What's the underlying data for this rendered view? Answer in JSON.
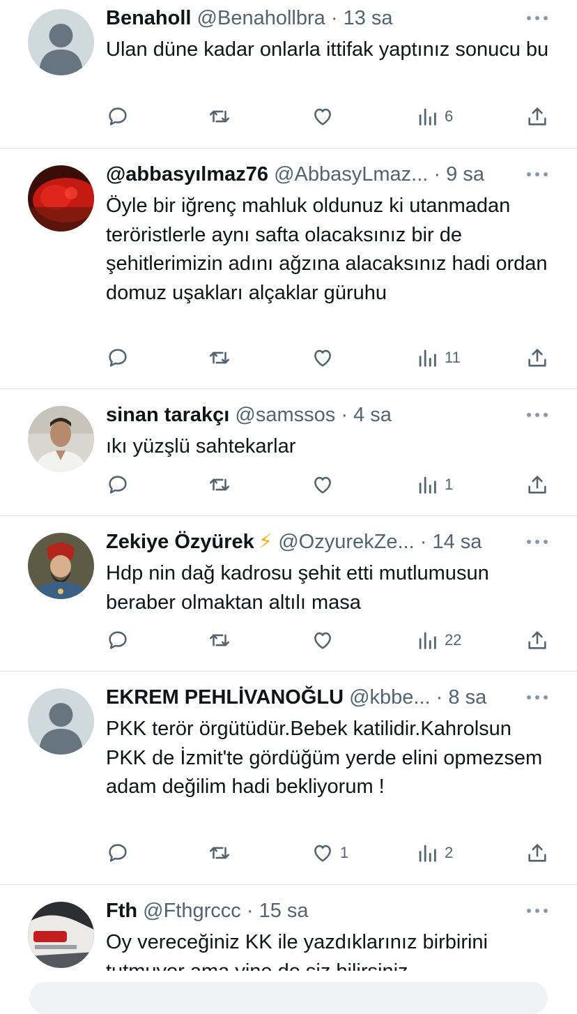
{
  "tweets": [
    {
      "name": "Benaholl",
      "handle": "@Benahollbra",
      "time": "13 sa",
      "text": "Ulan düne kadar onlarla ittifak yaptınız sonucu bu",
      "counts": {
        "reply": "",
        "retweet": "",
        "like": "",
        "views": "6"
      },
      "avatar": "default-avatar"
    },
    {
      "name": "@abbasyılmaz76",
      "handle": "@AbbasyLmaz...",
      "time": "9 sa",
      "text": "Öyle bir iğrenç mahluk oldunuz ki utanmadan  teröristlerle aynı safta olacaksınız bir de şehitlerimizin adını ağzına alacaksınız hadi ordan domuz uşakları alçaklar güruhu",
      "counts": {
        "reply": "",
        "retweet": "",
        "like": "",
        "views": "11"
      },
      "avatar": "red-flag-photo"
    },
    {
      "name": "sinan tarakçı",
      "handle": "@samssos",
      "time": "4 sa",
      "text": "ıkı yüzşlü sahtekarlar",
      "counts": {
        "reply": "",
        "retweet": "",
        "like": "",
        "views": "1"
      },
      "avatar": "man-photo"
    },
    {
      "name": "Zekiye Özyürek",
      "badge": "⚡",
      "handle": "@OzyurekZe...",
      "time": "14 sa",
      "text": "Hdp nin dağ kadrosu şehit etti mutlumusun beraber olmaktan  altılı  masa",
      "counts": {
        "reply": "",
        "retweet": "",
        "like": "",
        "views": "22"
      },
      "avatar": "sultan-portrait"
    },
    {
      "name": "EKREM PEHLİVANOĞLU",
      "handle": "@kbbe...",
      "time": "8 sa",
      "text": "PKK terör örgütüdür.Bebek katilidir.Kahrolsun PKK de İzmit'te gördüğüm yerde elini opmezsem adam değilim hadi bekliyorum !",
      "counts": {
        "reply": "",
        "retweet": "",
        "like": "1",
        "views": "2"
      },
      "avatar": "default-avatar"
    },
    {
      "name": "Fth",
      "handle": "@Fthgrccc",
      "time": "15 sa",
      "text": "Oy vereceğiniz KK ile yazdıklarınız birbirini tutmuyor ama yine de siz bilirsiniz...",
      "counts": {
        "reply": "",
        "retweet": "",
        "like": "",
        "views": ""
      },
      "avatar": "car-photo"
    }
  ],
  "separator": "·",
  "colors": {
    "text": "#0f1419",
    "secondary": "#536471",
    "divider": "#e1e6ea",
    "bolt": "#f6b21b"
  }
}
